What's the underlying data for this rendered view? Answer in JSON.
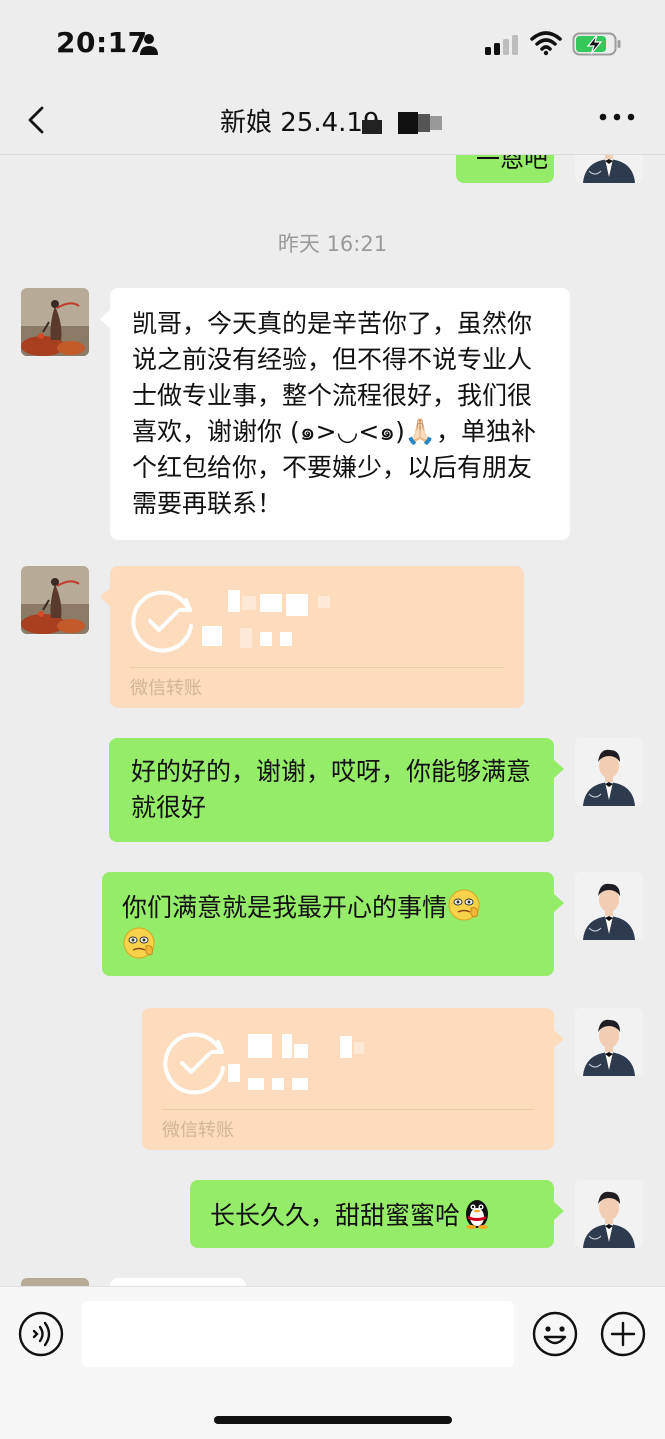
{
  "status_bar": {
    "time": "20:17"
  },
  "nav": {
    "title": "新娘 25.4.19"
  },
  "partial_message": {
    "text": "一恩吧"
  },
  "timestamp": "昨天 16:21",
  "messages": {
    "m1": {
      "text": "凯哥，今天真的是辛苦你了，虽然你说之前没有经验，但不得不说专业人士做专业事，整个流程很好，我们很喜欢，谢谢你 (๑>◡<๑)🙏🏻，单独补个红包给你，不要嫌少，以后有朋友需要再联系！"
    },
    "transfer1": {
      "label": "微信转账"
    },
    "m2": {
      "text": "好的好的，谢谢，哎呀，你能够满意就很好"
    },
    "m3": {
      "text": "你们满意就是我最开心的事情"
    },
    "transfer2": {
      "label": "微信转账"
    },
    "m4": {
      "text": "长长久久，甜甜蜜蜜哈"
    }
  },
  "input": {
    "placeholder": ""
  },
  "colors": {
    "background": "#ededed",
    "bubble_green": "#95ec69",
    "bubble_white": "#ffffff",
    "transfer_bg": "#fcdcbd",
    "timestamp": "#9a9a9a"
  },
  "icons": {
    "back": "chevron-left-icon",
    "more": "more-dots-icon",
    "voice": "voice-icon",
    "emoji": "emoji-face-icon",
    "plus": "plus-icon",
    "transfer": "transfer-check-icon"
  }
}
